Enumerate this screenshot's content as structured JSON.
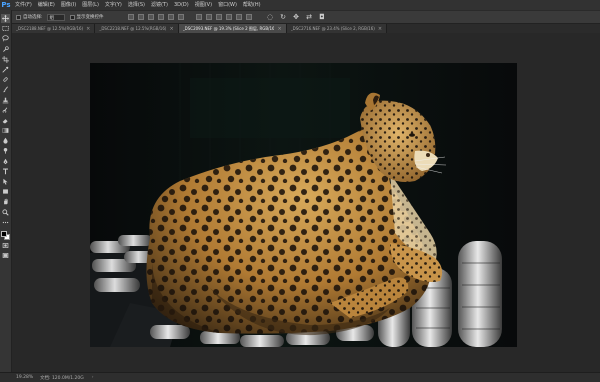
{
  "menubar": {
    "logo": "Ps",
    "items": [
      "文件(F)",
      "编辑(E)",
      "图像(I)",
      "图层(L)",
      "文字(Y)",
      "选择(S)",
      "滤镜(T)",
      "3D(D)",
      "视图(V)",
      "窗口(W)",
      "帮助(H)"
    ]
  },
  "options": {
    "auto_select_label": "自动选择:",
    "auto_select_value": "组",
    "show_transform_label": "显示变换控件"
  },
  "tabs": [
    {
      "title": "_DSC2188.NEF @ 12.5%(RGB/16)",
      "active": false
    },
    {
      "title": "_DSC2218.NEF @ 12.5%(RGB/16)",
      "active": false
    },
    {
      "title": "_DSC2093.NEF @ 19.3% (Slice 2 图层, RGB/16)",
      "active": true
    },
    {
      "title": "_DSC2716.NEF @ 23.4% (Slice 2, RGB/16)",
      "active": false
    }
  ],
  "tab_close_glyph": "×",
  "tools": [
    "move-tool-icon",
    "marquee-tool-icon",
    "lasso-tool-icon",
    "quick-select-tool-icon",
    "crop-tool-icon",
    "eyedropper-tool-icon",
    "healing-brush-icon",
    "brush-tool-icon",
    "clone-stamp-icon",
    "history-brush-icon",
    "eraser-tool-icon",
    "gradient-tool-icon",
    "blur-tool-icon",
    "dodge-tool-icon",
    "pen-tool-icon",
    "type-tool-icon",
    "path-select-icon",
    "rectangle-tool-icon",
    "hand-tool-icon",
    "zoom-tool-icon",
    "more-tools-icon"
  ],
  "status": {
    "zoom": "19.28%",
    "doc": "文档: 120.0M/1.20G",
    "arrow": "›"
  },
  "colors": {
    "foreground": "#000000",
    "background": "#ffffff",
    "accent": "#4aa3ff"
  }
}
